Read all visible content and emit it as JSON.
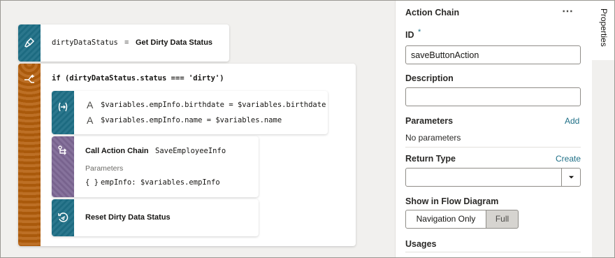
{
  "flow": {
    "get_status": {
      "variable": "dirtyDataStatus",
      "eq": "=",
      "action": "Get Dirty Data Status",
      "icon": "broom-icon"
    },
    "if_block": {
      "condition": "if (dirtyDataStatus.status === 'dirty')",
      "icon": "branch-icon"
    },
    "assign": {
      "icon": "assign-variables-icon",
      "lines": [
        "$variables.empInfo.birthdate = $variables.birthdate",
        "$variables.empInfo.name = $variables.name"
      ]
    },
    "call_chain": {
      "icon": "call-chain-icon",
      "title": "Call Action Chain",
      "chain_name": "SaveEmployeeInfo",
      "params_label": "Parameters",
      "param_glyph": "{ }",
      "param": "empInfo: $variables.empInfo"
    },
    "reset": {
      "icon": "reset-icon",
      "title": "Reset Dirty Data Status"
    }
  },
  "panel": {
    "title": "Action Chain",
    "more": "⋯",
    "id_label": "ID",
    "required_mark": "*",
    "id_value": "saveButtonAction",
    "description_label": "Description",
    "description_value": "",
    "parameters_label": "Parameters",
    "parameters_add": "Add",
    "parameters_empty": "No parameters",
    "return_type_label": "Return Type",
    "return_type_create": "Create",
    "return_type_value": "",
    "flow_label": "Show in Flow Diagram",
    "flow_options": [
      "Navigation Only",
      "Full"
    ],
    "flow_selected": "Full",
    "usages_label": "Usages"
  },
  "side_tab": {
    "label": "Properties"
  },
  "colors": {
    "teal": "#1e6f86",
    "orange": "#b55f0c",
    "purple": "#7d6794",
    "link": "#1e6f86"
  }
}
